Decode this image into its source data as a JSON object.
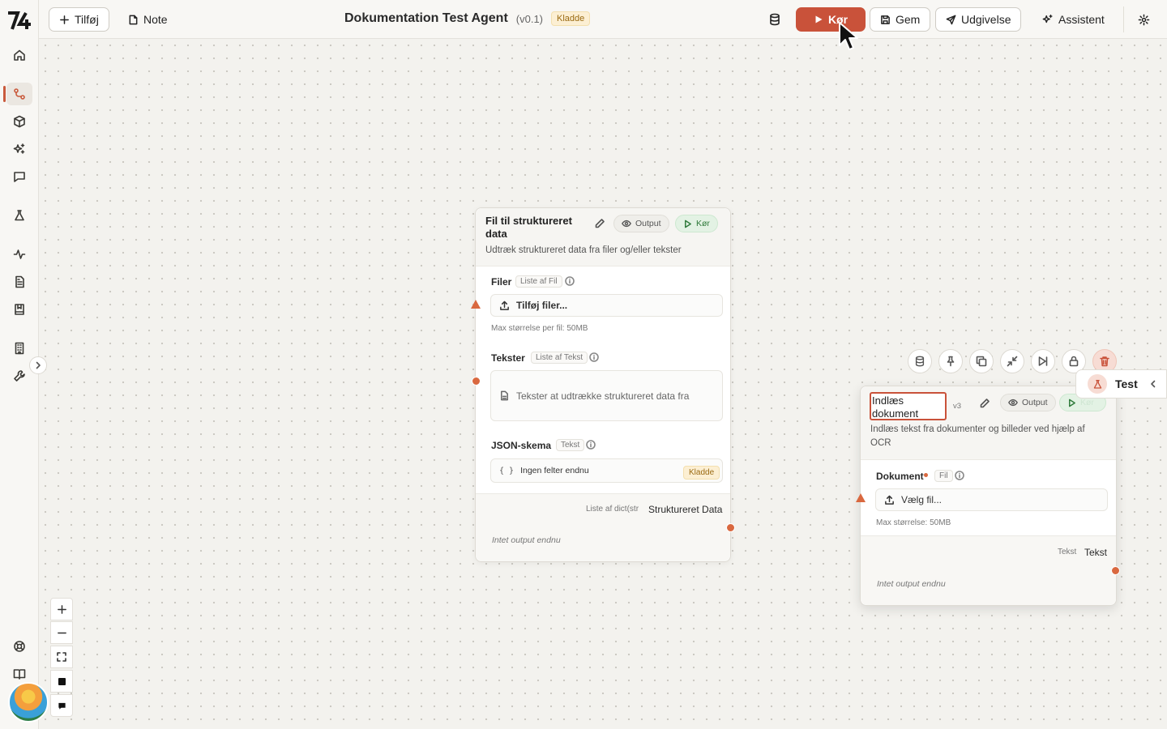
{
  "topbar": {
    "add_label": "Tilføj",
    "note_label": "Note",
    "title": "Dokumentation Test Agent",
    "version": "(v0.1)",
    "status_badge": "Kladde",
    "run_label": "Kør",
    "save_label": "Gem",
    "publish_label": "Udgivelse",
    "assistant_label": "Assistent"
  },
  "nodes": [
    {
      "title": "Fil til struktureret data",
      "description": "Udtræk struktureret data fra filer og/eller tekster",
      "output_label": "Output",
      "run_label": "Kør",
      "fields": [
        {
          "label": "Filer",
          "type": "Liste af Fil",
          "input": "Tilføj filer...",
          "hint": "Max størrelse per fil: 50MB"
        },
        {
          "label": "Tekster",
          "type": "Liste af Tekst",
          "input": "Tekster at udtrække struktureret data fra"
        },
        {
          "label": "JSON-skema",
          "type": "Tekst",
          "input": "Ingen felter endnu",
          "badge": "Kladde"
        }
      ],
      "output": {
        "type": "Liste af dict(str",
        "name": "Struktureret Data",
        "empty": "Intet output endnu"
      }
    },
    {
      "title": "Indlæs dokument",
      "version": "v3",
      "description": "Indlæs tekst fra dokumenter og billeder ved hjælp af OCR",
      "output_label": "Output",
      "run_label": "Kør",
      "fields": [
        {
          "label": "Dokument",
          "type": "Fil",
          "input": "Vælg fil...",
          "hint": "Max størrelse: 50MB"
        }
      ],
      "output": {
        "type": "Tekst",
        "name": "Tekst",
        "empty": "Intet output endnu"
      }
    }
  ],
  "test_panel": {
    "label": "Test"
  },
  "colors": {
    "accent": "#c9523a",
    "handle": "#d9683f",
    "run_green": "#2f7a3b",
    "draft_bg": "#fcefd3"
  }
}
